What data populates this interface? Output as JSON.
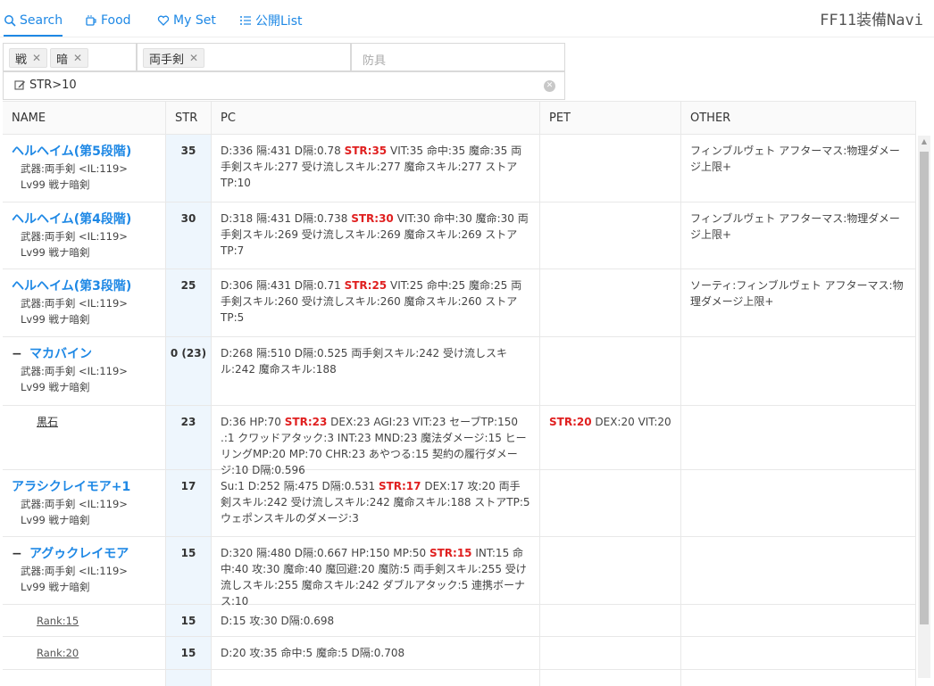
{
  "nav": {
    "tabs": [
      {
        "label": "Search",
        "icon": "search-icon"
      },
      {
        "label": "Food",
        "icon": "cup-icon"
      },
      {
        "label": "My Set",
        "icon": "heart-icon"
      },
      {
        "label": "公開List",
        "icon": "list-icon"
      }
    ],
    "brand": "FF11装備Navi"
  },
  "filters": {
    "jobs": [
      "戦",
      "暗"
    ],
    "weapon_type": "両手剣",
    "armor_placeholder": "防具",
    "query": "STR>10"
  },
  "table": {
    "headers": [
      "NAME",
      "STR",
      "PC",
      "PET",
      "OTHER"
    ],
    "rows": [
      {
        "name": "ヘルヘイム(第5段階)",
        "sub1": "武器:両手剣 <IL:119>",
        "sub2": "Lv99 戦ナ暗剣",
        "str": "35",
        "pc_pre": "D:336 隔:431 D隔:0.78 ",
        "pc_str": "STR:35",
        "pc_post": " VIT:35 命中:35 魔命:35 両手剣スキル:277 受け流しスキル:277 魔命スキル:277 ストアTP:10",
        "pet_str": "",
        "pet_post": "",
        "other": "フィンブルヴェト アフターマス:物理ダメージ上限+"
      },
      {
        "name": "ヘルヘイム(第4段階)",
        "sub1": "武器:両手剣 <IL:119>",
        "sub2": "Lv99 戦ナ暗剣",
        "str": "30",
        "pc_pre": "D:318 隔:431 D隔:0.738 ",
        "pc_str": "STR:30",
        "pc_post": " VIT:30 命中:30 魔命:30 両手剣スキル:269 受け流しスキル:269 魔命スキル:269 ストアTP:7",
        "pet_str": "",
        "pet_post": "",
        "other": "フィンブルヴェト アフターマス:物理ダメージ上限+"
      },
      {
        "name": "ヘルヘイム(第3段階)",
        "sub1": "武器:両手剣 <IL:119>",
        "sub2": "Lv99 戦ナ暗剣",
        "str": "25",
        "pc_pre": "D:306 隔:431 D隔:0.71 ",
        "pc_str": "STR:25",
        "pc_post": " VIT:25 命中:25 魔命:25 両手剣スキル:260 受け流しスキル:260 魔命スキル:260 ストアTP:5",
        "pet_str": "",
        "pet_post": "",
        "other": "ソーティ:フィンブルヴェト アフターマス:物理ダメージ上限+"
      },
      {
        "name": "マカバイン",
        "sub1": "武器:両手剣 <IL:119>",
        "sub2": "Lv99 戦ナ暗剣",
        "str": "0 (23)",
        "pc_pre": "D:268 隔:510 D隔:0.525 両手剣スキル:242 受け流しスキル:242 魔命スキル:188",
        "pc_str": "",
        "pc_post": "",
        "pet_str": "",
        "pet_post": "",
        "other": ""
      },
      {
        "name": "黒石",
        "str": "23",
        "pc_pre": "D:36 HP:70 ",
        "pc_str": "STR:23",
        "pc_post": " DEX:23 AGI:23 VIT:23 セーブTP:150 .:1 クワッドアタック:3 INT:23 MND:23 魔法ダメージ:15 ヒーリングMP:20 MP:70 CHR:23 あやつる:15 契約の履行ダメージ:10 D隔:0.596",
        "pet_str": "STR:20",
        "pet_post": " DEX:20 VIT:20",
        "other": ""
      },
      {
        "name": "アラシクレイモア+1",
        "sub1": "武器:両手剣 <IL:119>",
        "sub2": "Lv99 戦ナ暗剣",
        "str": "17",
        "pc_pre": "Su:1 D:252 隔:475 D隔:0.531 ",
        "pc_str": "STR:17",
        "pc_post": " DEX:17 攻:20 両手剣スキル:242 受け流しスキル:242 魔命スキル:188 ストアTP:5 ウェポンスキルのダメージ:3",
        "pet_str": "",
        "pet_post": "",
        "other": ""
      },
      {
        "name": "アグゥクレイモア",
        "sub1": "武器:両手剣 <IL:119>",
        "sub2": "Lv99 戦ナ暗剣",
        "str": "15",
        "pc_pre": "D:320 隔:480 D隔:0.667 HP:150 MP:50 ",
        "pc_str": "STR:15",
        "pc_post": " INT:15 命中:40 攻:30 魔命:40 魔回避:20 魔防:5 両手剣スキル:255 受け流しスキル:255 魔命スキル:242 ダブルアタック:5 連携ボーナス:10",
        "pet_str": "",
        "pet_post": "",
        "other": ""
      },
      {
        "name": "Rank:15",
        "str": "15",
        "pc_pre": "D:15 攻:30 D隔:0.698",
        "pc_str": "",
        "pc_post": "",
        "pet_str": "",
        "pet_post": "",
        "other": ""
      },
      {
        "name": "Rank:20",
        "str": "15",
        "pc_pre": "D:20 攻:35 命中:5 魔命:5 D隔:0.708",
        "pc_str": "",
        "pc_post": "",
        "pet_str": "",
        "pet_post": "",
        "other": ""
      }
    ]
  },
  "colors": {
    "accent": "#1e88e5",
    "stat_highlight": "#e02020"
  }
}
